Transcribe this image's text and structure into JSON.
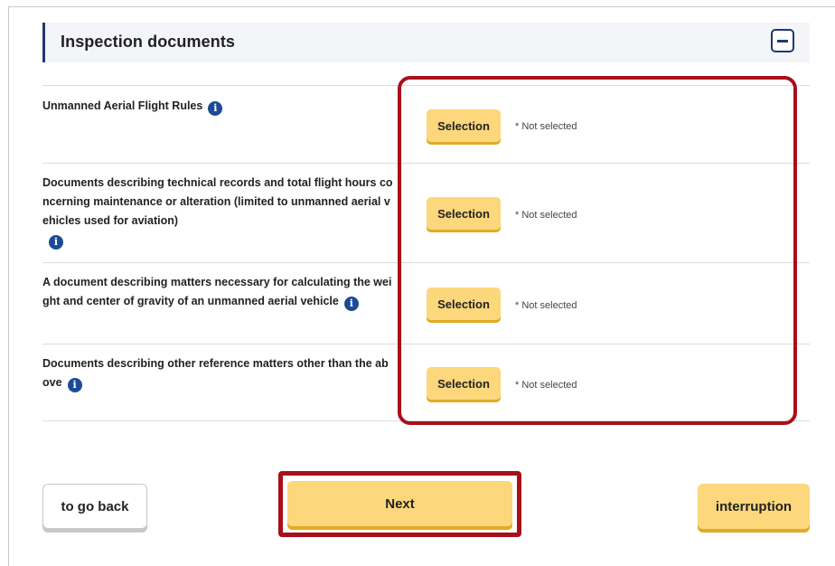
{
  "section": {
    "title": "Inspection documents"
  },
  "documents": [
    {
      "label": "Unmanned Aerial Flight Rules",
      "button": "Selection",
      "status": "* Not selected"
    },
    {
      "label": "Documents describing technical records and total flight hours concerning maintenance or alteration (limited to unmanned aerial vehicles used for aviation)",
      "button": "Selection",
      "status": "* Not selected"
    },
    {
      "label": "A document describing matters necessary for calculating the weight and center of gravity of an unmanned aerial vehicle",
      "button": "Selection",
      "status": "* Not selected"
    },
    {
      "label": "Documents describing other reference matters other than the above",
      "button": "Selection",
      "status": "* Not selected"
    }
  ],
  "footer": {
    "back_label": "to go back",
    "next_label": "Next",
    "interrupt_label": "interruption"
  },
  "colors": {
    "accent_button": "#fcd77b",
    "header_bar": "#1c3a73",
    "highlight": "#a8101a"
  },
  "icons": {
    "info": "info-icon",
    "collapse": "minus-square-icon"
  }
}
